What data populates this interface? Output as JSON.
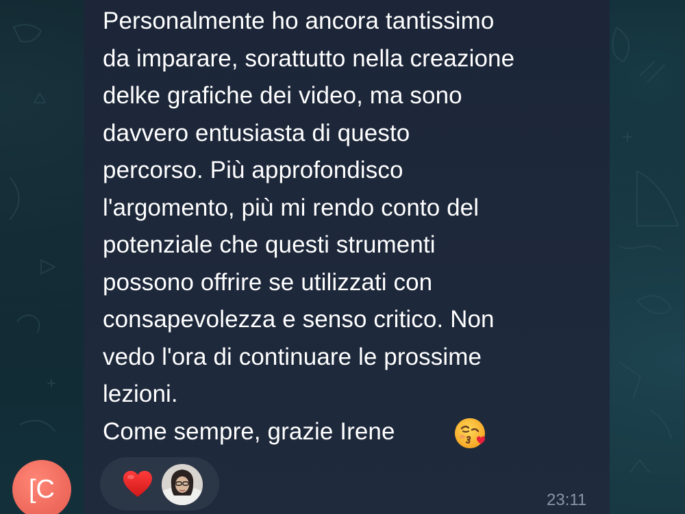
{
  "message": {
    "lines": [
      "Personalmente ho ancora tantissimo",
      "da imparare, sorattutto nella creazione",
      "delke grafiche dei video, ma sono",
      "davvero entusiasta di questo",
      "percorso. Più approfondisco",
      "l'argomento, più mi rendo conto del",
      "potenziale che questi strumenti",
      "possono offrire se utilizzati con",
      "consapevolezza e senso critico. Non",
      "vedo l'ora di continuare le prossime",
      "lezioni."
    ],
    "closing": "Come sempre, grazie Irene",
    "closing_emoji": "face-blowing-kiss-icon",
    "time": "23:11"
  },
  "reactions": {
    "emoji": "red-heart-icon",
    "reactor_avatar": "user-avatar-photo"
  },
  "sender": {
    "initials": "[C",
    "avatar_color": "#ef6b5d"
  },
  "colors": {
    "bubble": "#1e293b",
    "text": "#ffffff",
    "timestamp": "#8a96a8",
    "reaction_pill": "#2b3647",
    "heart": "#e0201f"
  }
}
